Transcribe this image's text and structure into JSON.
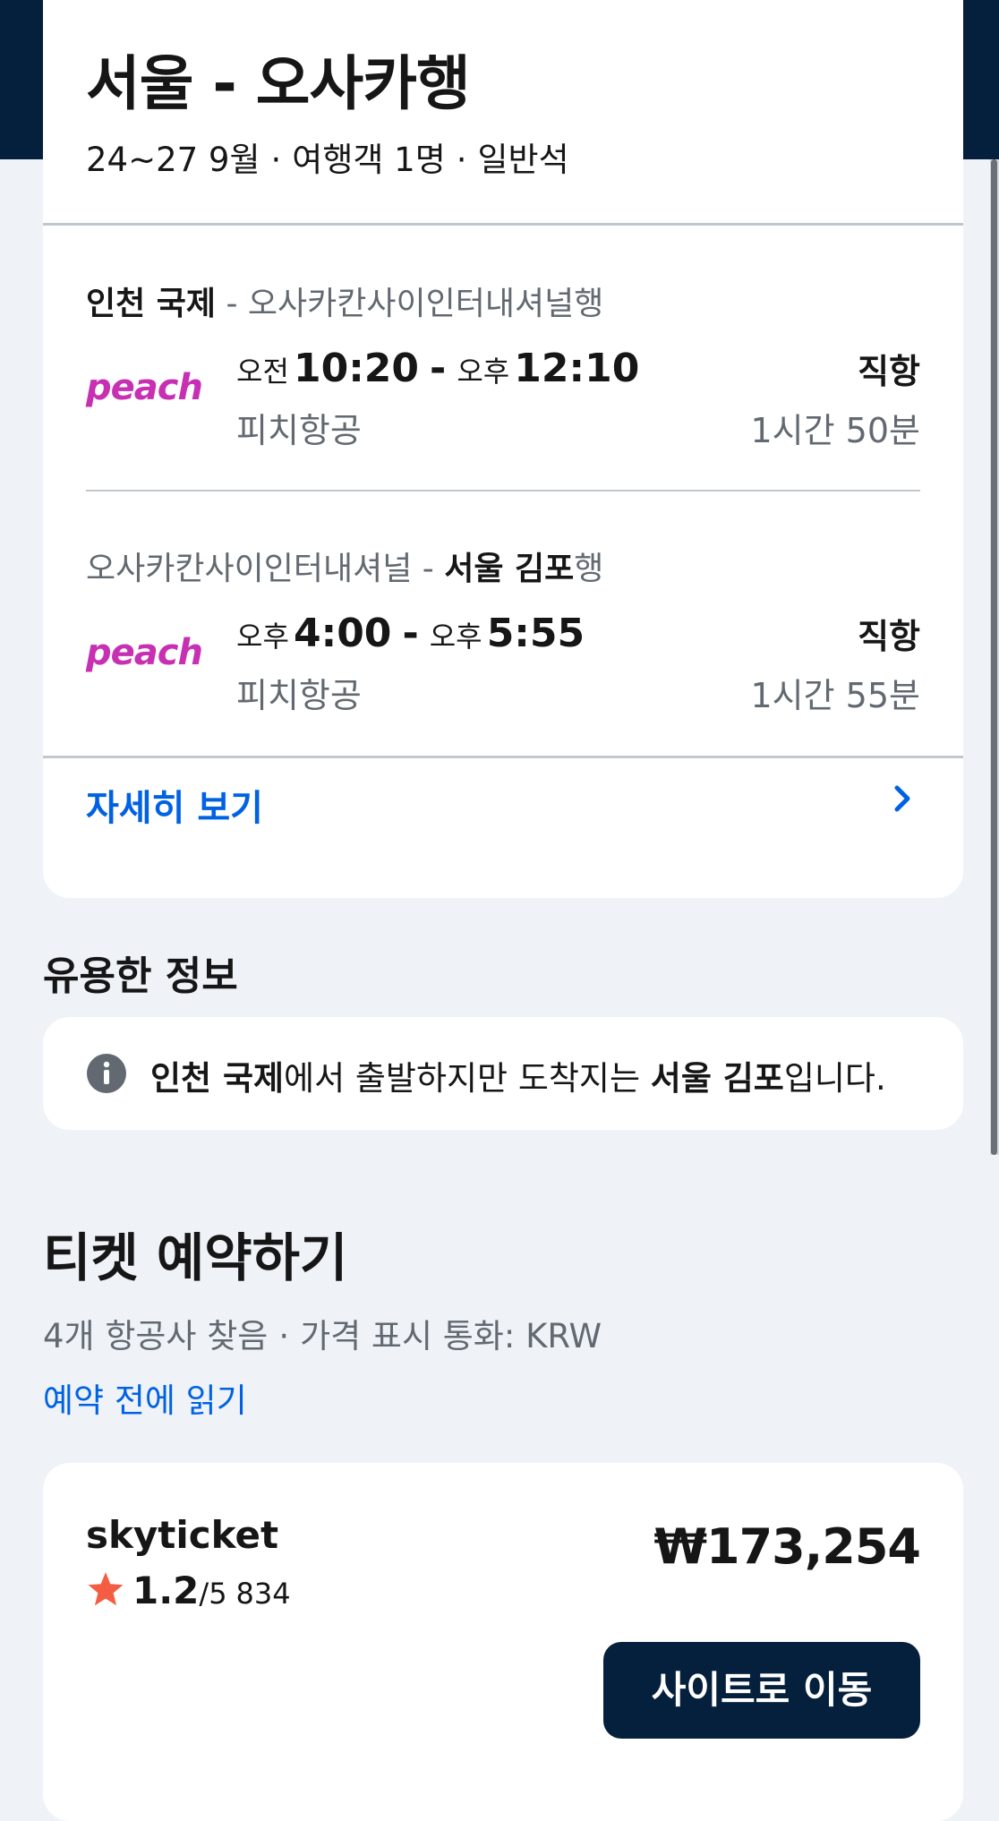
{
  "trip": {
    "title": "서울 - 오사카행",
    "dates": "24~27 9월",
    "passengers": "여행객 1명",
    "cabin": "일반석",
    "separator": "·"
  },
  "legs": [
    {
      "origin": "인천 국제",
      "route_sep": " - ",
      "destination": "오사카칸사이인터내셔널",
      "dest_suffix": "행",
      "airline_logo": "peach",
      "dep_ampm": "오전",
      "dep_time": "10:20",
      "arr_ampm": "오후",
      "arr_time": "12:10",
      "airline": "피치항공",
      "stops": "직항",
      "duration": "1시간 50분"
    },
    {
      "origin": "오사카칸사이인터내셔널",
      "route_sep": " - ",
      "destination": "서울 김포",
      "dest_suffix": "행",
      "airline_logo": "peach",
      "dep_ampm": "오후",
      "dep_time": "4:00",
      "arr_ampm": "오후",
      "arr_time": "5:55",
      "airline": "피치항공",
      "stops": "직항",
      "duration": "1시간 55분"
    }
  ],
  "details_link": "자세히 보기",
  "info": {
    "heading": "유용한 정보",
    "origin": "인천 국제",
    "text_mid": "에서 출발하지만 도착지는 ",
    "destination": "서울 김포",
    "text_end": "입니다."
  },
  "booking": {
    "heading": "티켓 예약하기",
    "providers_found": "4개 항공사 찾음",
    "currency_note": "가격 표시 통화: KRW",
    "separator": "·",
    "read_before": "예약 전에 읽기"
  },
  "provider": {
    "name": "skyticket",
    "rating": "1.2",
    "rating_out_of": "/5",
    "review_count": "834",
    "price": "₩173,254",
    "button_label": "사이트로 이동"
  },
  "colors": {
    "navy": "#05203c",
    "link_blue": "#0062e3",
    "peach_magenta": "#c730b3",
    "star_red": "#f55d42",
    "info_gray": "#626971"
  },
  "icons": {
    "chevron": "chevron-right-icon",
    "info": "info-icon",
    "star": "star-icon"
  }
}
